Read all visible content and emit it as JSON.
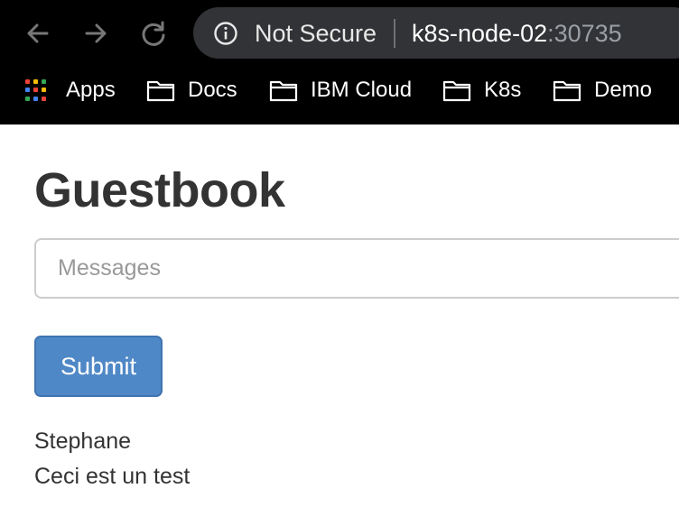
{
  "browser": {
    "security_label": "Not Secure",
    "url_host": "k8s-node-02",
    "url_port": ":30735",
    "bookmarks": [
      {
        "label": "Apps",
        "icon": "apps-grid-icon"
      },
      {
        "label": "Docs",
        "icon": "folder-icon"
      },
      {
        "label": "IBM Cloud",
        "icon": "folder-icon"
      },
      {
        "label": "K8s",
        "icon": "folder-icon"
      },
      {
        "label": "Demo",
        "icon": "folder-icon"
      }
    ]
  },
  "page": {
    "title": "Guestbook",
    "input_placeholder": "Messages",
    "submit_label": "Submit",
    "entries": [
      "Stephane",
      "Ceci est un test"
    ]
  },
  "colors": {
    "toolbar_bg": "#000000",
    "omnibox_bg": "#323336",
    "button_primary": "#4f88c6",
    "heading_text": "#333333"
  }
}
